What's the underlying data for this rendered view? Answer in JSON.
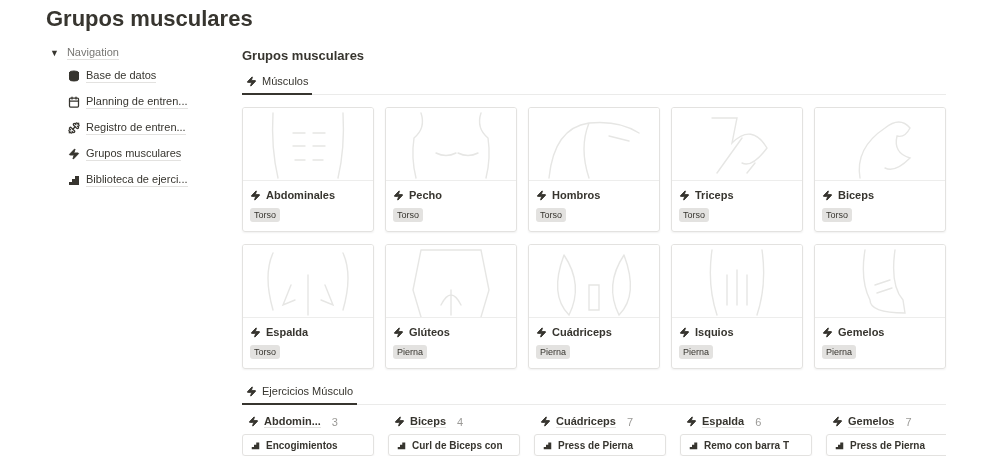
{
  "page_title": "Grupos musculares",
  "navigation": {
    "toggle": "▼",
    "label": "Navigation",
    "items": [
      {
        "kind": "database",
        "label": "Base de datos"
      },
      {
        "kind": "calendar",
        "label": "Planning de entren..."
      },
      {
        "kind": "dumbbell",
        "label": "Registro de entren..."
      },
      {
        "kind": "bolt",
        "label": "Grupos musculares"
      },
      {
        "kind": "stairs",
        "label": "Biblioteca de ejerci..."
      }
    ]
  },
  "gallery": {
    "title": "Grupos musculares",
    "tabs": [
      {
        "label": "Músculos",
        "selected": true
      }
    ],
    "cards": [
      {
        "name": "Abdominales",
        "tag": "Torso"
      },
      {
        "name": "Pecho",
        "tag": "Torso"
      },
      {
        "name": "Hombros",
        "tag": "Torso"
      },
      {
        "name": "Triceps",
        "tag": "Torso"
      },
      {
        "name": "Biceps",
        "tag": "Torso"
      },
      {
        "name": "Espalda",
        "tag": "Torso"
      },
      {
        "name": "Glúteos",
        "tag": "Pierna"
      },
      {
        "name": "Cuádriceps",
        "tag": "Pierna"
      },
      {
        "name": "Isquios",
        "tag": "Pierna"
      },
      {
        "name": "Gemelos",
        "tag": "Pierna"
      }
    ]
  },
  "board": {
    "tabs": [
      {
        "label": "Ejercicios Músculo",
        "selected": true
      }
    ],
    "columns": [
      {
        "name": "Abdomin...",
        "count": "3",
        "cards": [
          {
            "title": "Encogimientos"
          }
        ]
      },
      {
        "name": "Biceps",
        "count": "4",
        "cards": [
          {
            "title": "Curl de Biceps con"
          }
        ]
      },
      {
        "name": "Cuádriceps",
        "count": "7",
        "cards": [
          {
            "title": "Press de Pierna"
          }
        ]
      },
      {
        "name": "Espalda",
        "count": "6",
        "cards": [
          {
            "title": "Remo con barra T"
          }
        ]
      },
      {
        "name": "Gemelos",
        "count": "7",
        "cards": [
          {
            "title": "Press de Pierna"
          }
        ]
      }
    ]
  }
}
